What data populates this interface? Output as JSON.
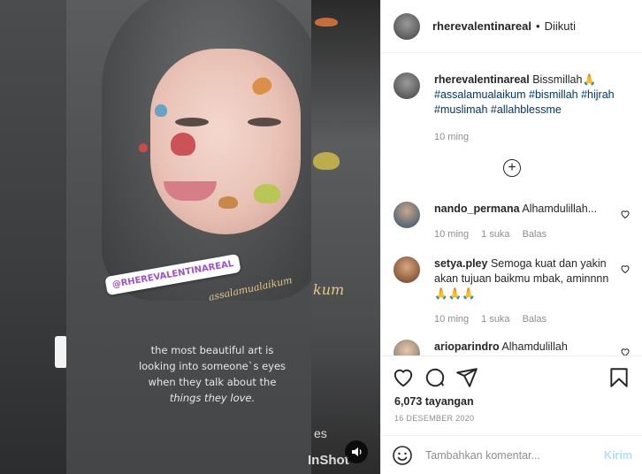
{
  "media": {
    "sticker_handle": "@RHEREVALENTINAREAL",
    "greeting_overlay": "assalamualaikum",
    "side_greeting_fragment": "kum",
    "quote_lines": [
      "the most beautiful art is",
      "looking into someone`s eyes",
      "when they talk about the",
      "things they love."
    ],
    "watermark": "InShot",
    "watermark_fragment": "es",
    "sound_icon": "speaker-icon"
  },
  "header": {
    "username": "rherevalentinareal",
    "separator": "•",
    "follow_status": "Diikuti"
  },
  "caption": {
    "username": "rherevalentinareal",
    "text": "Bissmillah🙏",
    "hashtags": [
      "#assalamualaikum",
      "#bismillah",
      "#hijrah",
      "#muslimah",
      "#allahblessme"
    ],
    "time": "10 ming"
  },
  "comments": [
    {
      "username": "nando_permana",
      "text": "Alhamdulillah...",
      "time": "10 ming",
      "likes": "1 suka",
      "reply": "Balas"
    },
    {
      "username": "setya.pley",
      "text": "Semoga kuat dan yakin akan tujuan baikmu mbak, aminnnn 🙏🙏🙏",
      "time": "10 ming",
      "likes": "1 suka",
      "reply": "Balas"
    },
    {
      "username": "arioparindro",
      "text": "Alhamdulillah"
    }
  ],
  "stats": {
    "views": "6,073 tayangan",
    "date": "16 DESEMBER 2020"
  },
  "composer": {
    "placeholder": "Tambahkan komentar...",
    "send_label": "Kirim"
  },
  "colors": {
    "link": "#00376b",
    "muted": "#8e8e8e",
    "send_disabled": "#b2dffc"
  }
}
